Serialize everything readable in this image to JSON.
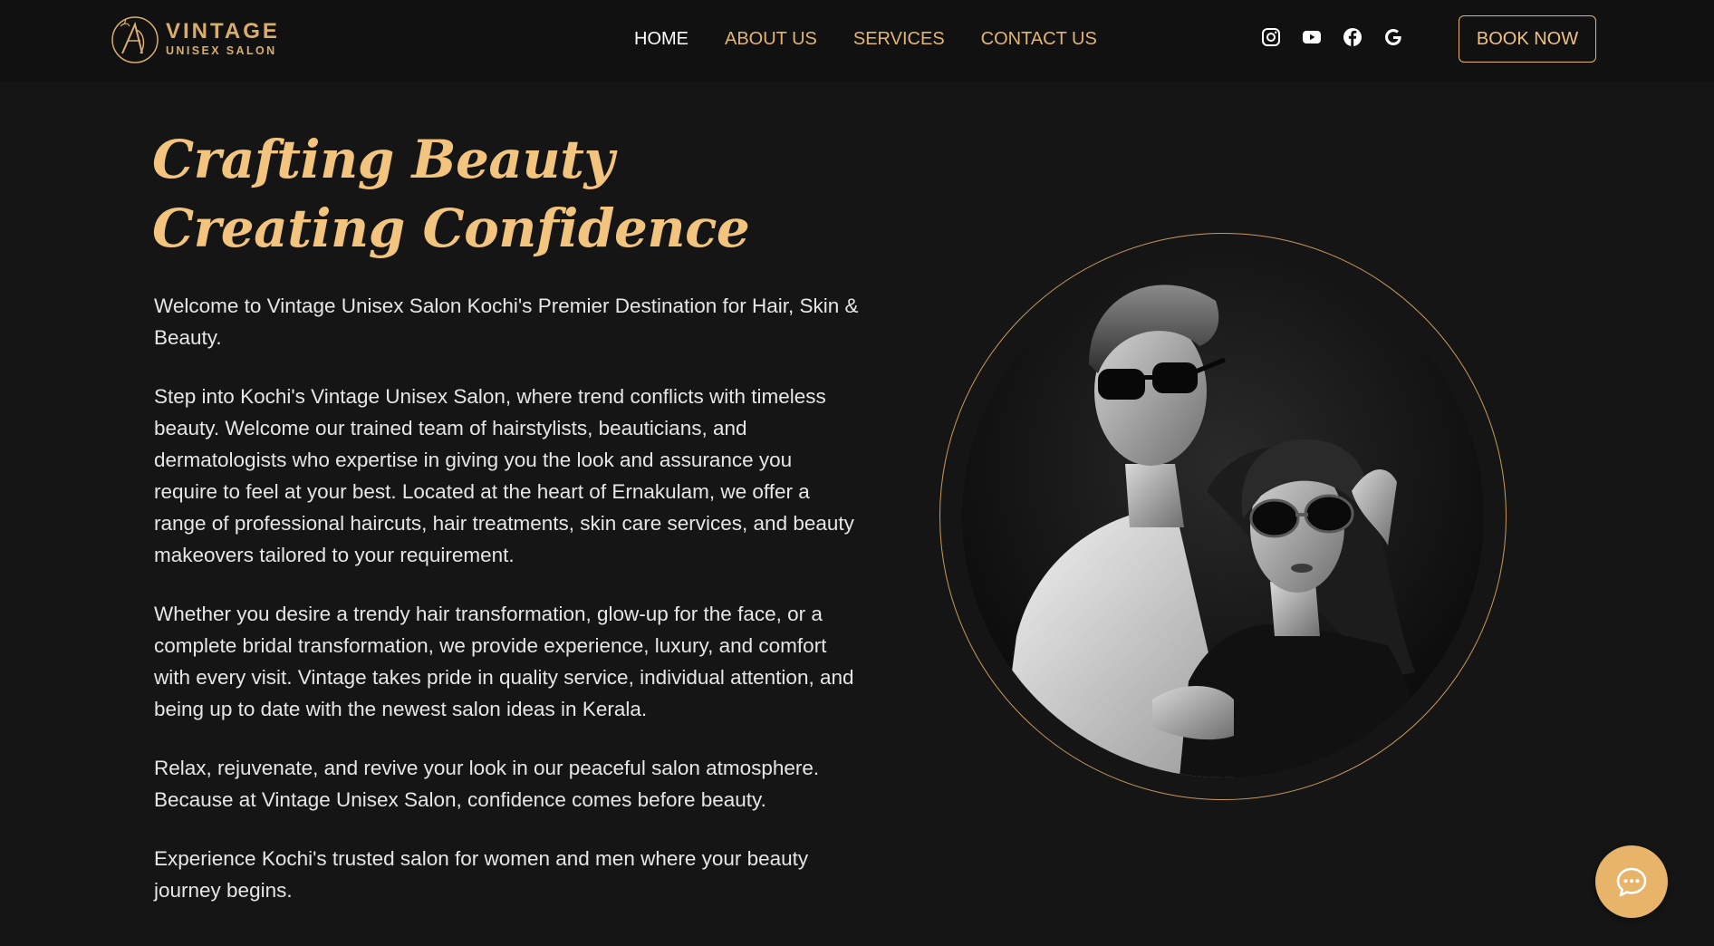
{
  "brand": {
    "name": "VINTAGE",
    "tagline": "UNISEX SALON",
    "accent_color": "#e2b570"
  },
  "nav": {
    "items": [
      {
        "label": "HOME",
        "active": true
      },
      {
        "label": "ABOUT US",
        "active": false
      },
      {
        "label": "SERVICES",
        "active": false
      },
      {
        "label": "CONTACT US",
        "active": false
      }
    ]
  },
  "social": {
    "icons": [
      "instagram-icon",
      "youtube-icon",
      "facebook-icon",
      "google-icon"
    ]
  },
  "cta": {
    "book_label": "BOOK NOW"
  },
  "hero": {
    "title_line1": "Crafting Beauty",
    "title_line2": "Creating Confidence",
    "paragraphs": [
      "Welcome to Vintage Unisex Salon Kochi's Premier Destination for Hair, Skin & Beauty.",
      "Step into Kochi's Vintage Unisex Salon, where trend conflicts with timeless beauty. Welcome our trained team of hairstylists, beauticians, and dermatologists who expertise in giving you the look and assurance you require to feel at your best. Located at the heart of Ernakulam, we offer a range of professional haircuts, hair treatments, skin care services, and beauty makeovers tailored to your requirement.",
      "Whether you desire a trendy hair transformation, glow-up for the face, or a complete bridal transformation, we provide experience, luxury, and comfort with every visit. Vintage takes pride in quality service, individual attention, and being up to date with the newest salon ideas in Kerala.",
      "Relax, rejuvenate, and revive your look in our peaceful salon atmosphere. Because at Vintage Unisex Salon, confidence comes before beauty.",
      "Experience Kochi's trusted salon for women and men where your beauty journey begins."
    ]
  },
  "chat": {
    "icon": "chat-bubble-icon",
    "color": "#e7b46a"
  }
}
